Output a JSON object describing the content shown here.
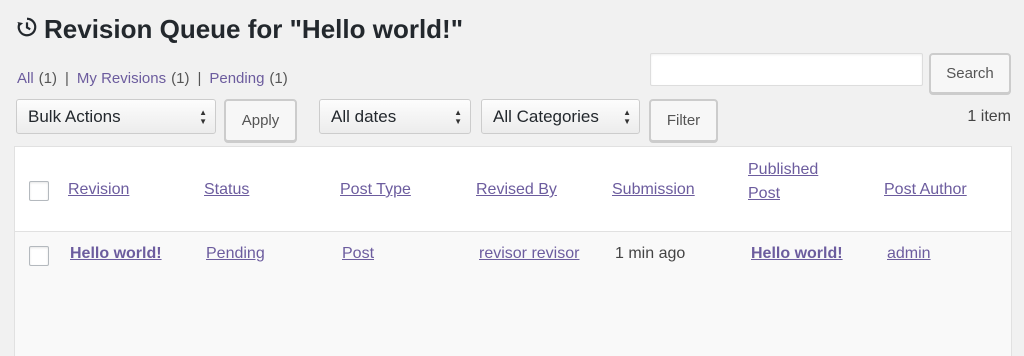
{
  "header": {
    "title": "Revision Queue for \"Hello world!\""
  },
  "views": {
    "all_label": "All",
    "all_count": "(1)",
    "mine_label": "My Revisions",
    "mine_count": "(1)",
    "pending_label": "Pending",
    "pending_count": "(1)",
    "separator": "|"
  },
  "search": {
    "placeholder": "",
    "value": "",
    "button_label": "Search"
  },
  "filters": {
    "bulk_actions": "Bulk Actions",
    "apply_label": "Apply",
    "dates": "All dates",
    "categories": "All Categories",
    "filter_label": "Filter",
    "items_count": "1 item"
  },
  "table": {
    "columns": {
      "revision": "Revision",
      "status": "Status",
      "post_type": "Post Type",
      "revised_by": "Revised By",
      "submission": "Submission",
      "published_line1": "Published",
      "published_line2": "Post",
      "post_author": "Post Author"
    },
    "rows": [
      {
        "revision": "Hello world!",
        "status": "Pending",
        "post_type": "Post",
        "revised_by": "revisor revisor",
        "submission": "1 min ago",
        "published_post": "Hello world!",
        "post_author": "admin"
      }
    ]
  },
  "colors": {
    "link": "#6c5c9e",
    "background": "#f1f1f1"
  },
  "icons": {
    "title_icon": "history-icon"
  }
}
